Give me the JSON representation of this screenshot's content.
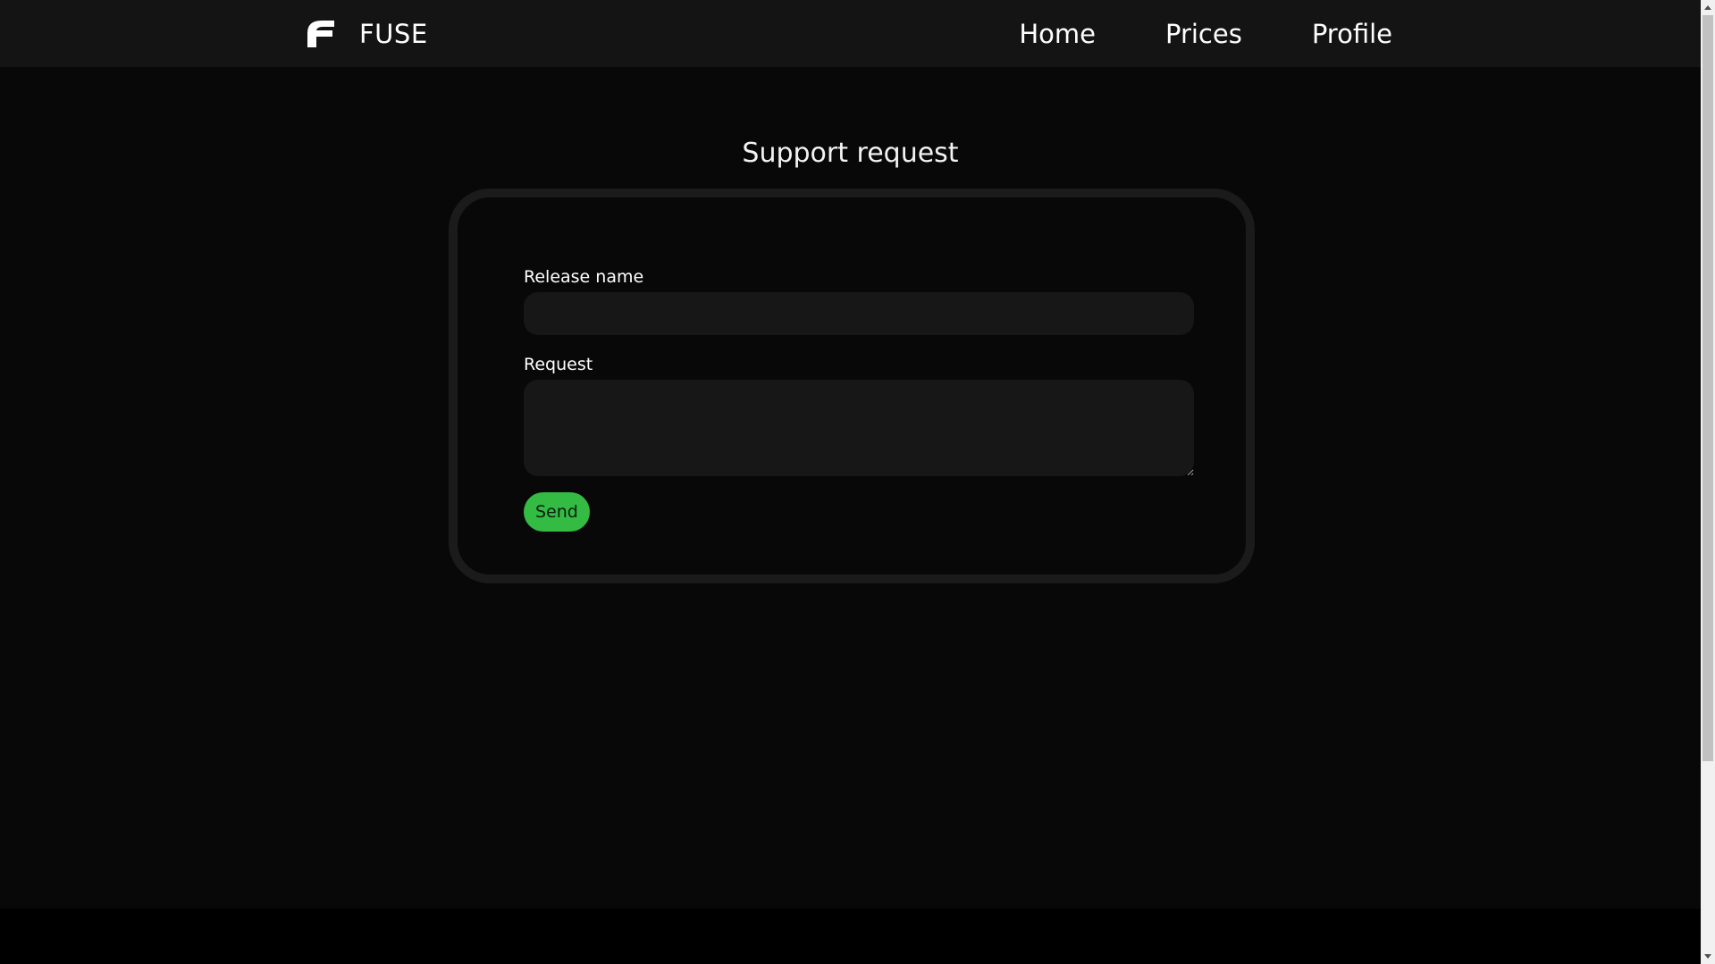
{
  "header": {
    "brand_name": "FUSE",
    "logo_icon": "fuse-logo-icon",
    "nav": [
      {
        "label": "Home"
      },
      {
        "label": "Prices"
      },
      {
        "label": "Profile"
      }
    ]
  },
  "main": {
    "title": "Support request",
    "form": {
      "release_name_label": "Release name",
      "release_name_value": "",
      "request_label": "Request",
      "request_value": "",
      "send_label": "Send"
    }
  },
  "colors": {
    "header_bg": "#141414",
    "page_bg": "#070807",
    "card_border": "#1a1b1a",
    "input_bg": "#161716",
    "accent_green": "#34bb44",
    "text": "#ffffff"
  }
}
